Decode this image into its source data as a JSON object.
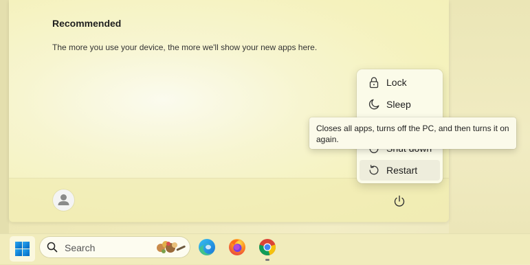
{
  "start_menu": {
    "recommended_title": "Recommended",
    "recommended_text": "The more you use your device, the more we'll show your new apps here."
  },
  "power_menu": {
    "items": [
      {
        "label": "Lock",
        "icon": "lock-icon"
      },
      {
        "label": "Sleep",
        "icon": "moon-icon"
      },
      {
        "label": "Shut down",
        "icon": "power-icon"
      },
      {
        "label": "Restart",
        "icon": "restart-icon"
      }
    ]
  },
  "tooltip": {
    "text": "Closes all apps, turns off the PC, and then turns it on again."
  },
  "taskbar": {
    "search_label": "Search",
    "apps": [
      {
        "icon": "windows-start-icon"
      },
      {
        "icon": "edge-icon"
      },
      {
        "icon": "firefox-icon"
      },
      {
        "icon": "chrome-icon"
      }
    ]
  },
  "colors": {
    "accent_blue": "#0067c0",
    "background": "#f3f0b9"
  }
}
